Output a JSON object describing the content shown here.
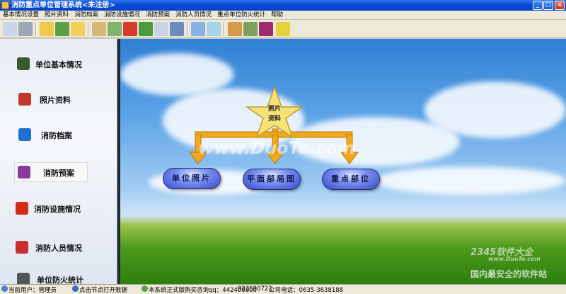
{
  "window": {
    "title": "消防重点单位管理系统<未注册>"
  },
  "menu": [
    "基本情况设置",
    "照片资料",
    "消防档案",
    "消防设施情况",
    "消防预案",
    "消防人员情况",
    "重点单位防火统计",
    "帮助"
  ],
  "toolbar": {
    "icons": [
      "exit-icon",
      "print-icon",
      "folder-icon",
      "book-icon",
      "folder-open-icon",
      "certificate-icon",
      "rescue-icon",
      "umbrella-icon",
      "notebook-icon",
      "search-doc-icon",
      "brush-icon",
      "flashlight-icon",
      "glasses-icon",
      "picture-icon",
      "calculator-icon",
      "book-red-icon",
      "runner-icon"
    ]
  },
  "sidebar": {
    "items": [
      {
        "label": "单位基本情况",
        "icon": "unit-info-icon",
        "color": "#3a5a2c"
      },
      {
        "label": "照片资料",
        "icon": "photo-icon",
        "color": "#c0392b"
      },
      {
        "label": "消防档案",
        "icon": "archive-icon",
        "color": "#1f6fd0"
      },
      {
        "label": "消防预案",
        "icon": "plan-icon",
        "color": "#8b3a9a",
        "selected": true
      },
      {
        "label": "消防设施情况",
        "icon": "extinguisher-icon",
        "color": "#d42a1a"
      },
      {
        "label": "消防人员情况",
        "icon": "firefighter-icon",
        "color": "#c83030"
      },
      {
        "label": "单位防火统计",
        "icon": "statistics-icon",
        "color": "#555555"
      }
    ]
  },
  "diagram": {
    "root": {
      "line1": "照片",
      "line2": "资料"
    },
    "children": [
      "单位照片",
      "平面部局图",
      "重点部位"
    ],
    "arrow_color": "#f3a81c"
  },
  "watermarks": {
    "main": "www.DuoTe.com",
    "brand": "2345软件大全",
    "brand_url": "www.DuoTe.com",
    "slogan": "国内最安全的软件站"
  },
  "status": {
    "user": "当前用户：管理员",
    "hint": "点击节点打开数据",
    "purchase": "本系统正式版购买咨询qq：442400800",
    "qq2": "923690722",
    "phone": "公司电话：0635-3638188"
  }
}
